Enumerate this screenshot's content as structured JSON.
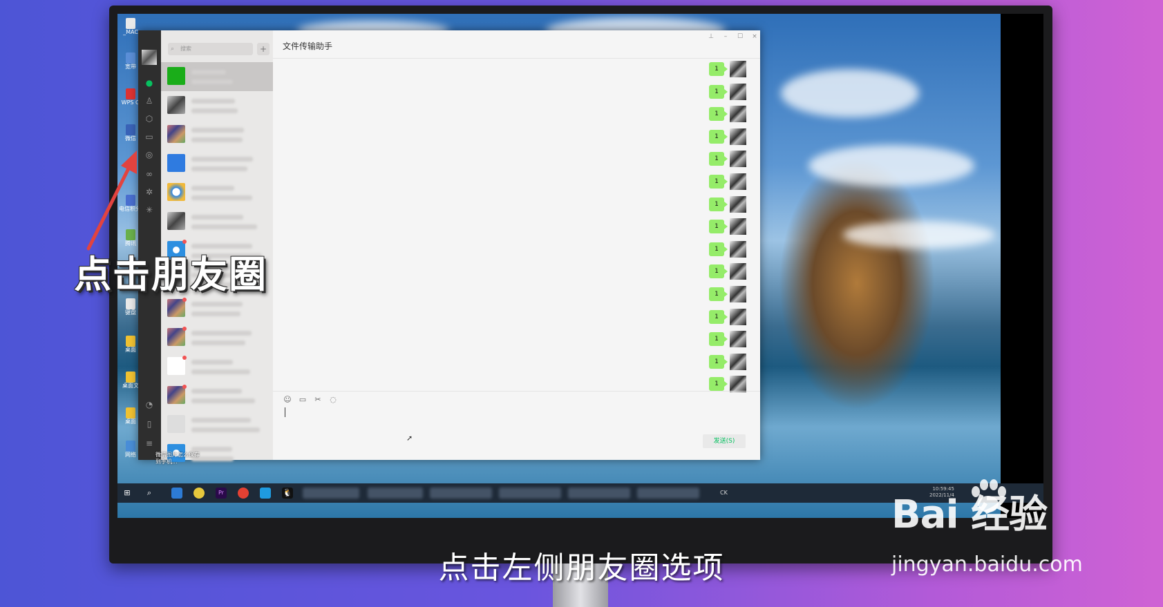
{
  "window": {
    "chat_title": "文件传输助手",
    "search_placeholder": "搜索",
    "add_label": "+",
    "send_label": "发送(S)",
    "message_text": "1",
    "controls": {
      "pin": "⊥",
      "minimize": "–",
      "maximize": "☐",
      "close": "×"
    }
  },
  "desktop_icons": [
    {
      "label": "_MAC"
    },
    {
      "label": "宽带"
    },
    {
      "label": "WPS O"
    },
    {
      "label": "微信"
    },
    {
      "label": "电信积分说"
    },
    {
      "label": "腾讯"
    },
    {
      "label": "键盘"
    },
    {
      "label": "桌面"
    },
    {
      "label": "桌面文"
    },
    {
      "label": "桌面"
    },
    {
      "label": "网络"
    }
  ],
  "chat_list": [
    {
      "id": "c1",
      "avatar": "folder-green",
      "badge": false,
      "active": true
    },
    {
      "id": "c2",
      "avatar": "photo",
      "badge": false
    },
    {
      "id": "c3",
      "avatar": "group",
      "badge": false
    },
    {
      "id": "c4",
      "avatar": "blue-app",
      "badge": false
    },
    {
      "id": "c5",
      "avatar": "qq-blue",
      "badge": false
    },
    {
      "id": "c6",
      "avatar": "photo",
      "badge": false
    },
    {
      "id": "c7",
      "avatar": "ie-blue",
      "badge": true
    },
    {
      "id": "c8",
      "avatar": "photo",
      "badge": false
    },
    {
      "id": "c9",
      "avatar": "group",
      "badge": true
    },
    {
      "id": "c10",
      "avatar": "group",
      "badge": true
    },
    {
      "id": "c11",
      "avatar": "triangle-blue",
      "badge": true
    },
    {
      "id": "c12",
      "avatar": "group",
      "badge": true
    },
    {
      "id": "c13",
      "avatar": "default-user",
      "badge": false
    },
    {
      "id": "c14",
      "avatar": "ie-blue",
      "badge": false
    }
  ],
  "chat_list_footer": "微信图片怎么保存到手机...",
  "messages_count": 15,
  "rail_icons": [
    "chat-icon",
    "contacts-icon",
    "favorites-icon",
    "files-icon",
    "moments-icon",
    "channels-icon",
    "search-icon",
    "mini-programs-icon",
    "miniapp-icon",
    "phone-icon",
    "menu-icon"
  ],
  "taskbar": {
    "tray_text": "CK",
    "clock_time": "10:59:45",
    "clock_date": "2022/11/4"
  },
  "overlay": {
    "annotation": "点击朋友圈",
    "subtitle": "点击左侧朋友圈选项",
    "watermark_logo": "Bai 经验",
    "watermark_url": "jingyan.baidu.com"
  },
  "colors": {
    "bubble": "#95ec69",
    "send_text": "#07c160",
    "arrow": "#e2433f",
    "rail": "#2e2e2e"
  }
}
